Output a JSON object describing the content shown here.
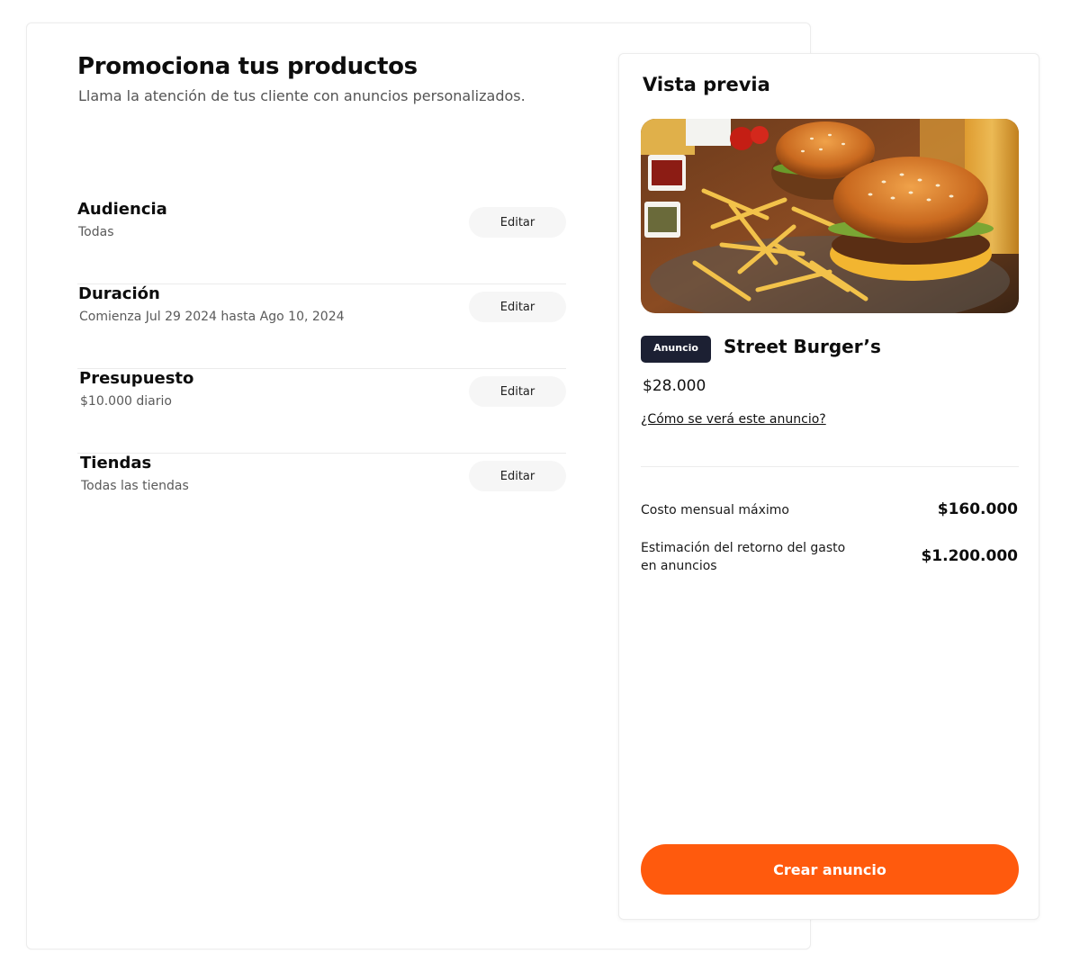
{
  "header": {
    "title": "Promociona tus productos",
    "subtitle": "Llama la atención de tus cliente con anuncios personalizados."
  },
  "settings": [
    {
      "title": "Audiencia",
      "value": "Todas",
      "button": "Editar"
    },
    {
      "title": "Duración",
      "value": "Comienza Jul 29 2024 hasta Ago 10, 2024",
      "button": "Editar"
    },
    {
      "title": "Presupuesto",
      "value": "$10.000 diario",
      "button": "Editar"
    },
    {
      "title": "Tiendas",
      "value": "Todas las tiendas",
      "button": "Editar"
    }
  ],
  "preview": {
    "title": "Vista previa",
    "badge": "Anuncio",
    "product_name": "Street Burger’s",
    "price": "$28.000",
    "link": "¿Cómo se verá este anuncio?",
    "metrics": [
      {
        "label": "Costo mensual máximo",
        "value": "$160.000"
      },
      {
        "label": "Estimación del retorno del gasto en anuncios",
        "value": "$1.200.000"
      }
    ],
    "cta": "Crear anuncio"
  },
  "colors": {
    "accent": "#ff5a0d",
    "badge": "#1c2033"
  }
}
